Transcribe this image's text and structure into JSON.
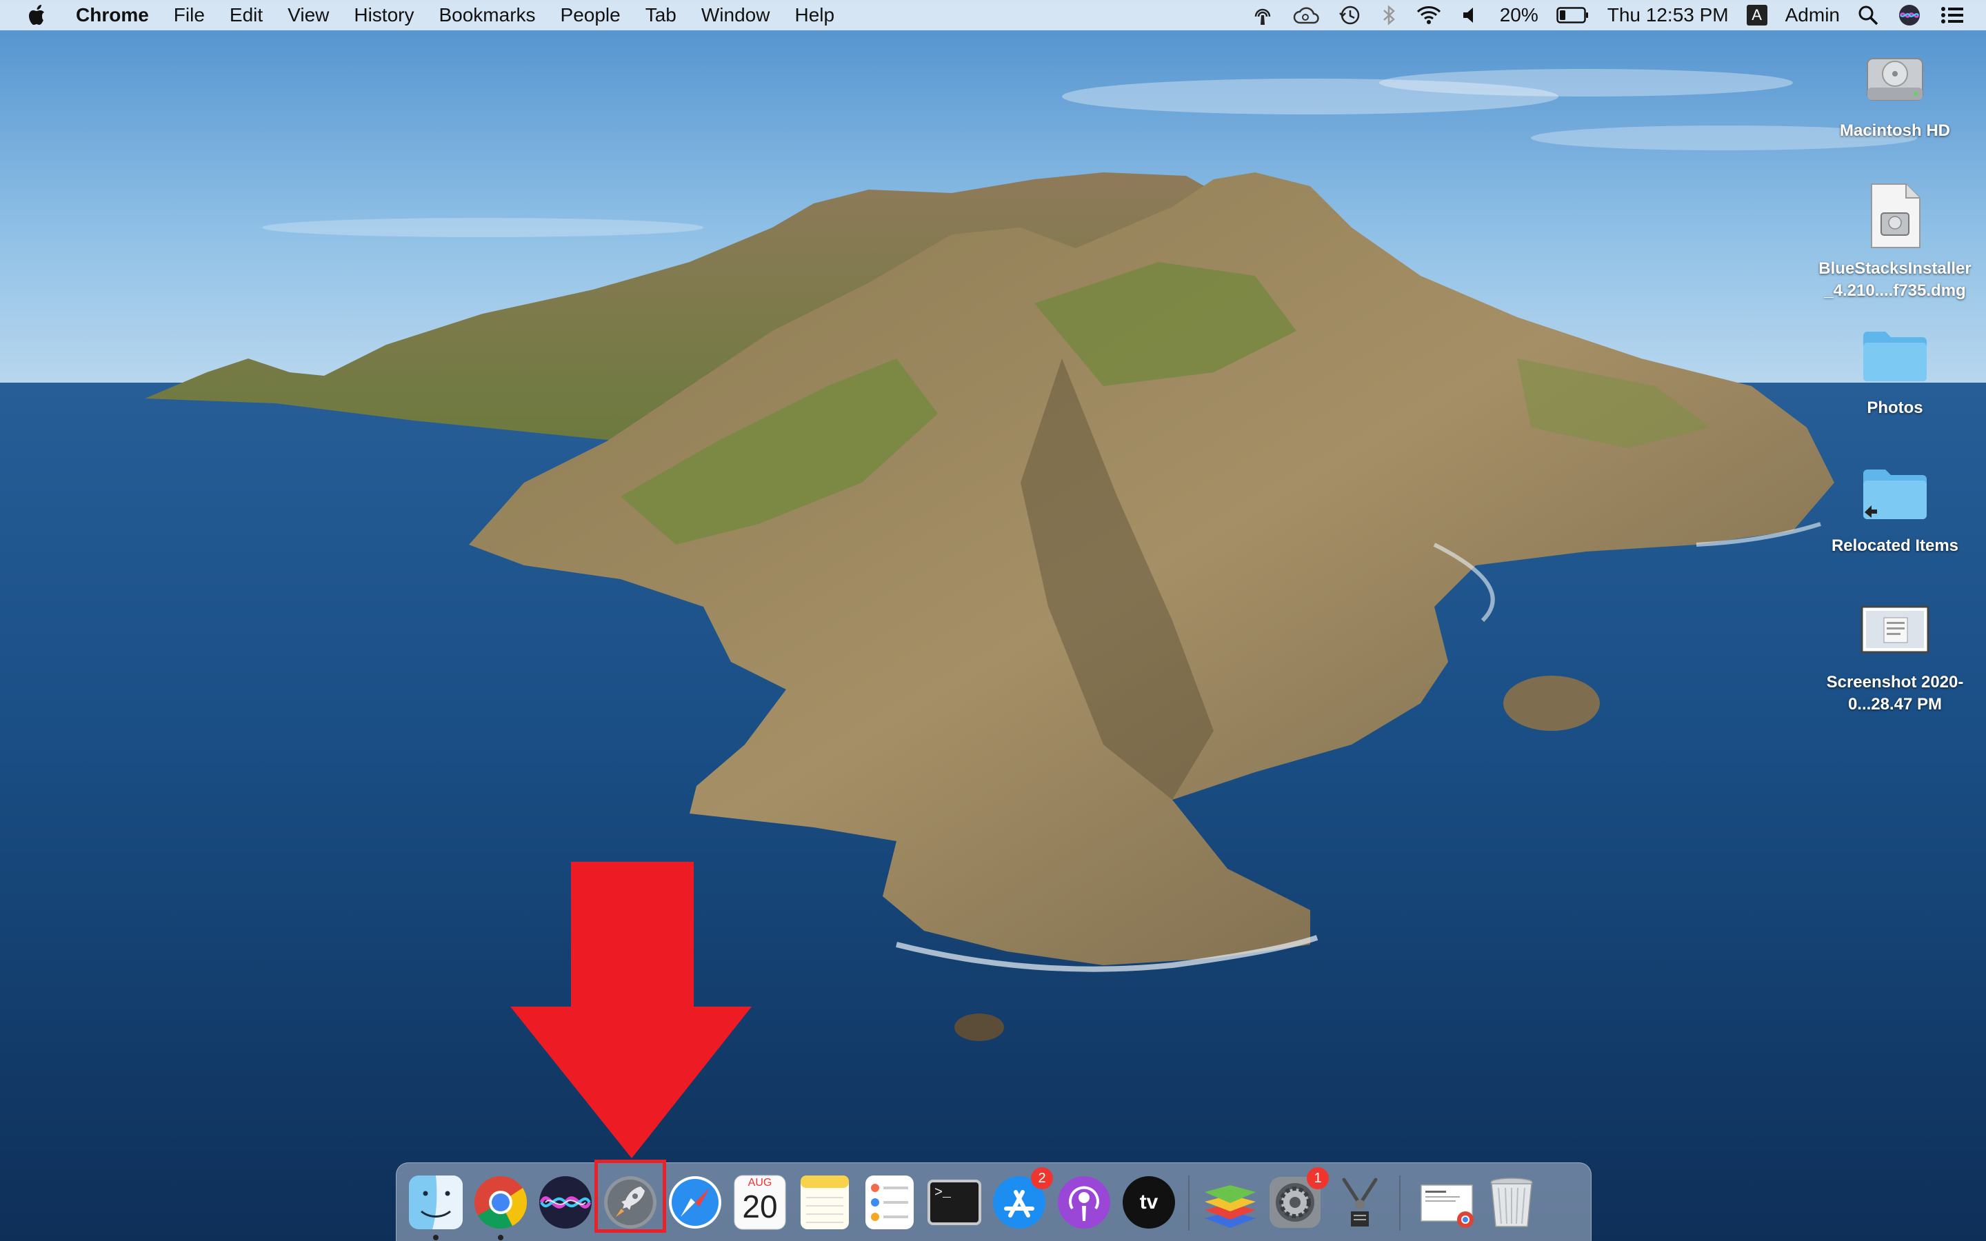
{
  "menubar": {
    "app_name": "Chrome",
    "menus": [
      "File",
      "Edit",
      "View",
      "History",
      "Bookmarks",
      "People",
      "Tab",
      "Window",
      "Help"
    ],
    "battery": "20%",
    "clock": "Thu 12:53 PM",
    "input_source": "A",
    "user": "Admin",
    "status_icons": [
      "airdrop-icon",
      "creative-cloud-icon",
      "time-machine-icon",
      "bluetooth-icon",
      "wifi-icon",
      "volume-icon",
      "battery-icon",
      "input-source-icon",
      "spotlight-icon",
      "siri-icon",
      "notification-center-icon"
    ]
  },
  "desktop_icons": [
    {
      "label": "Macintosh HD",
      "icon": "hard-drive-icon"
    },
    {
      "label": "BlueStacksInstaller_4.210....f735.dmg",
      "icon": "dmg-file-icon"
    },
    {
      "label": "Photos",
      "icon": "folder-icon"
    },
    {
      "label": "Relocated Items",
      "icon": "folder-alias-icon"
    },
    {
      "label": "Screenshot 2020-0...28.47 PM",
      "icon": "screenshot-thumbnail-icon"
    }
  ],
  "dock": {
    "apps": [
      {
        "name": "Finder",
        "icon": "finder-icon",
        "running": true
      },
      {
        "name": "Google Chrome",
        "icon": "chrome-icon",
        "running": true
      },
      {
        "name": "Siri",
        "icon": "siri-icon",
        "running": false
      },
      {
        "name": "Launchpad",
        "icon": "launchpad-icon",
        "running": false,
        "highlighted": true
      },
      {
        "name": "Safari",
        "icon": "safari-icon",
        "running": false
      },
      {
        "name": "Calendar",
        "icon": "calendar-icon",
        "running": false
      },
      {
        "name": "Notes",
        "icon": "notes-icon",
        "running": false
      },
      {
        "name": "Reminders",
        "icon": "reminders-icon",
        "running": false
      },
      {
        "name": "Terminal",
        "icon": "terminal-icon",
        "running": false
      },
      {
        "name": "App Store",
        "icon": "app-store-icon",
        "running": false
      },
      {
        "name": "Podcasts",
        "icon": "podcasts-icon",
        "running": false
      },
      {
        "name": "TV",
        "icon": "apple-tv-icon",
        "running": false
      },
      {
        "name": "BlueStacks",
        "icon": "bluestacks-icon",
        "running": false
      },
      {
        "name": "System Preferences",
        "icon": "system-preferences-icon",
        "running": false
      },
      {
        "name": "Screenshot Utility",
        "icon": "screenshot-tool-icon",
        "running": false
      },
      {
        "name": "Downloads Stack",
        "icon": "stack-icon",
        "running": false
      },
      {
        "name": "Trash",
        "icon": "trash-icon",
        "running": false
      }
    ],
    "calendar_month": "AUG",
    "calendar_day": "20",
    "app_store_badge": "2",
    "system_prefs_badge": "1",
    "terminal_prompt": ">_",
    "tv_label": "tv"
  },
  "annotation": {
    "arrow_color": "#ed1c24",
    "highlight_target": "Launchpad"
  },
  "colors": {
    "menubar_bg": "#e8f0f8",
    "badge_red": "#f0352f",
    "folder_blue": "#6ec3f3"
  }
}
